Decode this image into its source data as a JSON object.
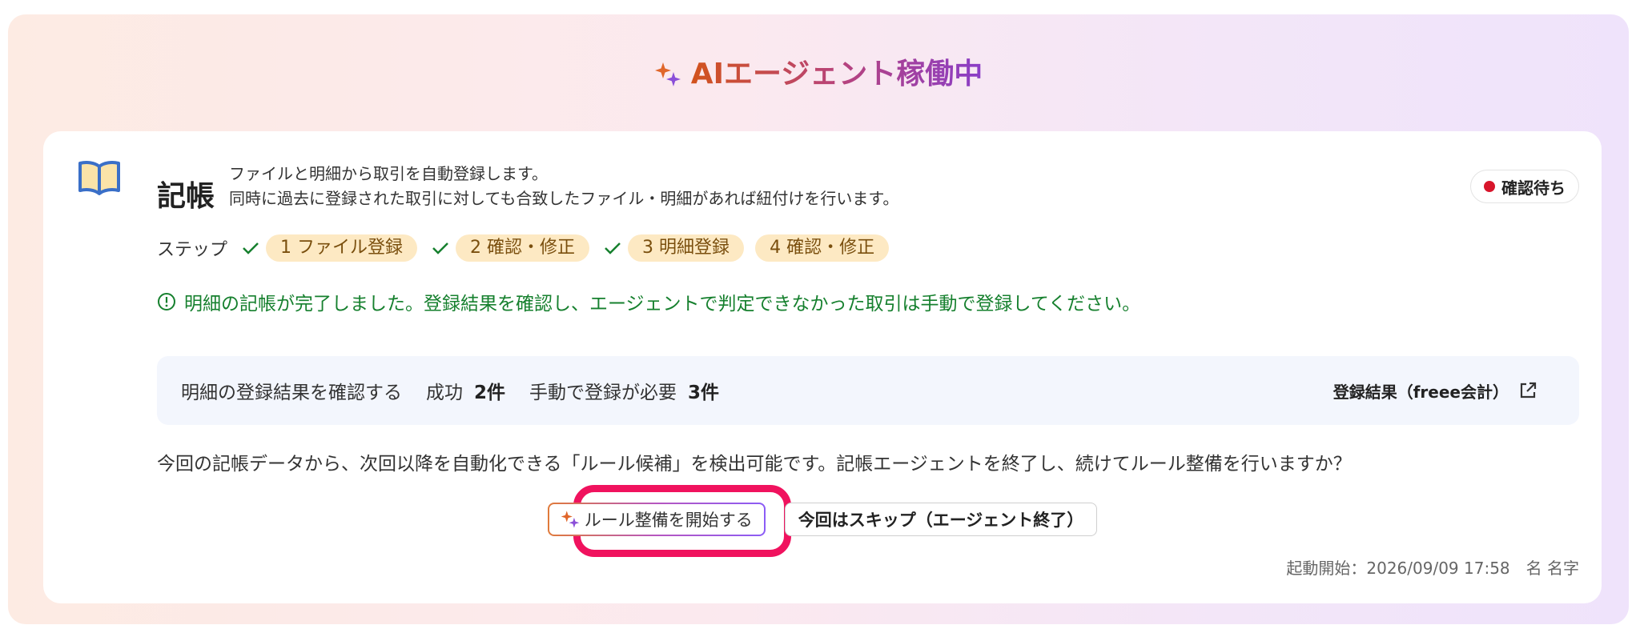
{
  "banner": {
    "title": "AIエージェント稼働中",
    "icon": "sparkle-icon"
  },
  "card": {
    "title": "記帳",
    "description": [
      "ファイルと明細から取引を自動登録します。",
      "同時に過去に登録された取引に対しても合致したファイル・明細があれば紐付けを行います。"
    ],
    "status": {
      "label": "確認待ち",
      "color": "#d8152b"
    },
    "steps_label": "ステップ",
    "steps": [
      {
        "number": "1",
        "label": "ファイル登録",
        "done": true
      },
      {
        "number": "2",
        "label": "確認・修正",
        "done": true
      },
      {
        "number": "3",
        "label": "明細登録",
        "done": true
      },
      {
        "number": "4",
        "label": "確認・修正",
        "done": false
      }
    ],
    "notice": "明細の記帳が完了しました。登録結果を確認し、エージェントで判定できなかった取引は手動で登録してください。",
    "results": {
      "label": "明細の登録結果を確認する",
      "success_label": "成功",
      "success_value": "2件",
      "manual_label": "手動で登録が必要",
      "manual_value": "3件",
      "link_label": "登録結果（freee会計）"
    },
    "question": "今回の記帳データから、次回以降を自動化できる「ルール候補」を検出可能です。記帳エージェントを終了し、続けてルール整備を行いますか？",
    "primary_button": "ルール整備を開始する",
    "secondary_button": "今回はスキップ（エージェント終了）",
    "footer": "起動開始：2026/09/09 17:58　名 名字"
  },
  "colors": {
    "accent_green": "#16802e",
    "step_pill": "#fde9c3",
    "highlight": "#f0125e"
  }
}
